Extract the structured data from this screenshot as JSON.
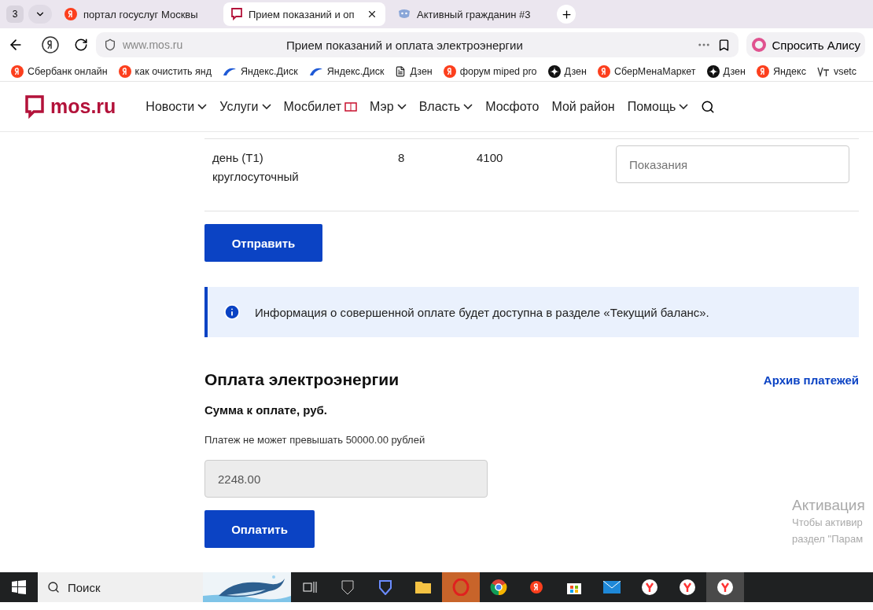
{
  "browser": {
    "tab_count": "3",
    "tabs": [
      {
        "label": "портал госуслуг Москвы",
        "selected": false
      },
      {
        "label": "Прием показаний и оп",
        "selected": true
      },
      {
        "label": "Активный гражданин #3",
        "selected": false
      }
    ],
    "url": "www.mos.ru",
    "page_title": "Прием показаний и оплата электроэнергии",
    "alice": "Спросить Алису",
    "bookmarks": [
      "Сбербанк онлайн",
      "как очистить янд",
      "Яндекс.Диск",
      "Яндекс.Диск",
      "Дзен",
      "форум miped pro",
      "Дзен",
      "СберМенаМаркет",
      "Дзен",
      "Яндекс",
      "vsetc"
    ]
  },
  "site": {
    "logo": "mos.ru",
    "nav": [
      {
        "label": "Новости",
        "dropdown": true
      },
      {
        "label": "Услуги",
        "dropdown": true
      },
      {
        "label": "Мосбилет",
        "dropdown": false,
        "ticket": true
      },
      {
        "label": "Мэр",
        "dropdown": true
      },
      {
        "label": "Власть",
        "dropdown": true
      },
      {
        "label": "Мосфото",
        "dropdown": false
      },
      {
        "label": "Мой район",
        "dropdown": false
      },
      {
        "label": "Помощь",
        "dropdown": true
      }
    ]
  },
  "readings": {
    "rows": [
      {
        "tariff": "день (Т1)\nкруглосуточный",
        "column_2": "8",
        "column_3": "4100",
        "placeholder": "Показания"
      }
    ],
    "submit": "Отправить"
  },
  "info": "Информация о совершенной оплате будет доступна в разделе «Текущий баланс».",
  "payment": {
    "title": "Оплата электроэнергии",
    "archive": "Архив платежей",
    "amount_label": "Сумма к оплате, руб.",
    "hint": "Платеж не может превышать 50000.00 рублей",
    "amount": "2248.00",
    "pay": "Оплатить"
  },
  "activation": {
    "title": "Активация",
    "line_1": "Чтобы активир",
    "line_2": "раздел \"Парам"
  },
  "taskbar": {
    "search": "Поиск"
  }
}
